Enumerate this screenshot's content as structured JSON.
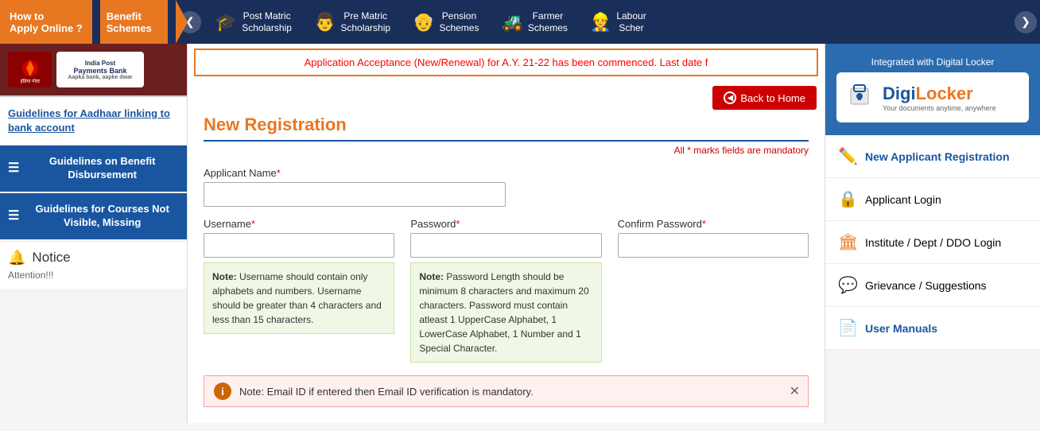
{
  "nav": {
    "apply_online": "How to\nApply Online ?",
    "benefit_schemes": "Benefit\nSchemes",
    "left_arrow": "❮",
    "right_arrow": "❯",
    "items": [
      {
        "id": "post-matric",
        "icon": "🎓",
        "label": "Post Matric\nScholarship"
      },
      {
        "id": "pre-matric",
        "icon": "👨",
        "label": "Pre Matric\nScholarship"
      },
      {
        "id": "pension",
        "icon": "👴",
        "label": "Pension\nSchemes"
      },
      {
        "id": "farmer",
        "icon": "🚜",
        "label": "Farmer\nSchemes"
      },
      {
        "id": "labour",
        "icon": "👷",
        "label": "Labour\nScher"
      }
    ]
  },
  "announcement": "Application Acceptance (New/Renewal) for A.Y. 21-22 has been commenced. Last date f",
  "back_button": "Back to Home",
  "form": {
    "title": "New Registration",
    "mandatory_note": "All * marks fields are mandatory",
    "applicant_name_label": "Applicant Name",
    "applicant_name_required": "*",
    "applicant_name_placeholder": "",
    "username_label": "Username",
    "username_required": "*",
    "username_placeholder": "",
    "username_note_label": "Note:",
    "username_note": " Username should contain only alphabets and numbers. Username should be greater than 4 characters and less than 15 characters.",
    "password_label": "Password",
    "password_required": "*",
    "password_placeholder": "",
    "password_note_label": "Note:",
    "password_note": " Password Length should be minimum 8 characters and maximum 20 characters. Password must contain atleast 1 UpperCase Alphabet, 1 LowerCase Alphabet, 1 Number and 1 Special Character.",
    "confirm_password_label": "Confirm Password",
    "confirm_password_required": "*",
    "confirm_password_placeholder": "",
    "email_warning": "Note: Email ID if entered then Email ID verification is mandatory."
  },
  "left_sidebar": {
    "aadhaar_link": "Guidelines for Aadhaar linking to bank account",
    "guidelines": [
      {
        "id": "benefit",
        "icon": "☰",
        "text": "Guidelines on Benefit Disbursement"
      },
      {
        "id": "courses",
        "icon": "☰",
        "text": "Guidelines for Courses Not Visible, Missing"
      }
    ],
    "notice_label": "Notice",
    "attention_text": "Attention!!!"
  },
  "right_sidebar": {
    "integrated_text": "Integrated with Digital Locker",
    "digi_name_black": "Digi",
    "digi_name_orange": "Locker",
    "digi_tagline": "Your documents anytime, anywhere",
    "menu": [
      {
        "id": "new-applicant",
        "icon": "✏️",
        "label": "New Applicant Registration",
        "active": true
      },
      {
        "id": "applicant-login",
        "icon": "🔒",
        "label": "Applicant Login",
        "active": false
      },
      {
        "id": "institute-login",
        "icon": "🏛",
        "label": "Institute / Dept / DDO Login",
        "active": false
      },
      {
        "id": "grievance",
        "icon": "💬",
        "label": "Grievance / Suggestions",
        "active": false
      },
      {
        "id": "user-manuals",
        "icon": "📄",
        "label": "User Manuals",
        "active": true
      }
    ]
  }
}
